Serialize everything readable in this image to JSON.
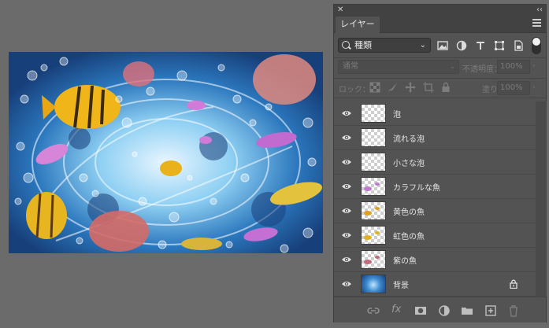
{
  "panel": {
    "close_glyph": "✕",
    "collapse_glyph": "‹‹",
    "tab_label": "レイヤー",
    "filter": {
      "kind_value": "種類",
      "icons": [
        "image-filter-icon",
        "adjustment-filter-icon",
        "type-filter-icon",
        "shape-filter-icon",
        "smart-object-filter-icon"
      ]
    },
    "blend_mode": "通常",
    "opacity_label": "不透明度：",
    "opacity_value": "100%",
    "lock_label": "ロック：",
    "fill_label": "塗り：",
    "fill_value": "100%",
    "layers": [
      {
        "name": "泡",
        "visible": true,
        "thumb": "transparent"
      },
      {
        "name": "流れる泡",
        "visible": true,
        "thumb": "transparent"
      },
      {
        "name": "小さな泡",
        "visible": true,
        "thumb": "transparent"
      },
      {
        "name": "カラフルな魚",
        "visible": true,
        "thumb": "fish"
      },
      {
        "name": "黄色の魚",
        "visible": true,
        "thumb": "fish"
      },
      {
        "name": "虹色の魚",
        "visible": true,
        "thumb": "fish"
      },
      {
        "name": "紫の魚",
        "visible": true,
        "thumb": "fish"
      },
      {
        "name": "背景",
        "visible": true,
        "thumb": "background",
        "locked": true
      }
    ],
    "bottom_icons": [
      "link-layers-icon",
      "fx-icon",
      "add-mask-icon",
      "adjustment-layer-icon",
      "new-group-icon",
      "new-layer-icon",
      "delete-layer-icon"
    ],
    "fx_glyph": "fx"
  },
  "colors": {
    "workspace": "#6b6b6b",
    "panel": "#535353",
    "canvas_base": "#1d4f8c"
  }
}
